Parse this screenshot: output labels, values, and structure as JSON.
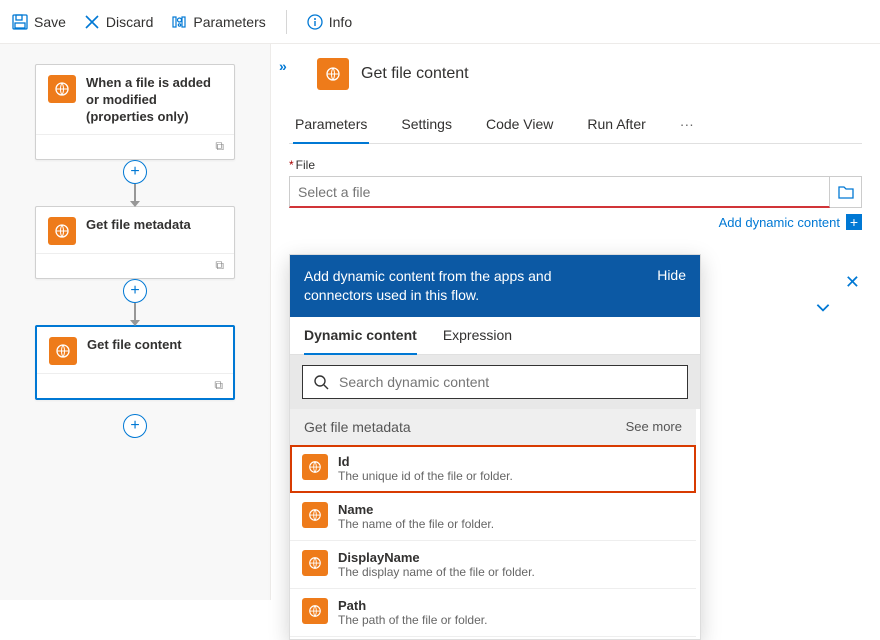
{
  "toolbar": {
    "save": "Save",
    "discard": "Discard",
    "parameters": "Parameters",
    "info": "Info"
  },
  "flow": {
    "trigger": "When a file is added or modified (properties only)",
    "action1": "Get file metadata",
    "action2": "Get file content"
  },
  "panel": {
    "title": "Get file content",
    "tabs": {
      "parameters": "Parameters",
      "settings": "Settings",
      "codeview": "Code View",
      "runafter": "Run After"
    },
    "field_label": "File",
    "file_placeholder": "Select a file",
    "add_dynamic": "Add dynamic content"
  },
  "dynamic": {
    "banner": "Add dynamic content from the apps and connectors used in this flow.",
    "hide": "Hide",
    "tab_dynamic": "Dynamic content",
    "tab_expression": "Expression",
    "search_placeholder": "Search dynamic content",
    "section": "Get file metadata",
    "see_more": "See more",
    "items": [
      {
        "name": "Id",
        "desc": "The unique id of the file or folder."
      },
      {
        "name": "Name",
        "desc": "The name of the file or folder."
      },
      {
        "name": "DisplayName",
        "desc": "The display name of the file or folder."
      },
      {
        "name": "Path",
        "desc": "The path of the file or folder."
      }
    ]
  }
}
